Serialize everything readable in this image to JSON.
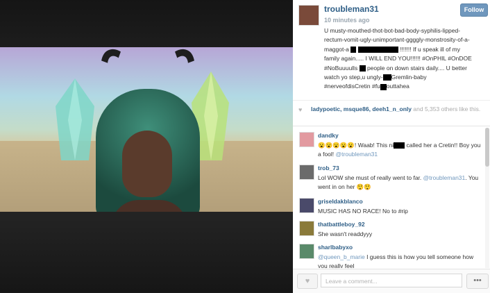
{
  "post": {
    "username": "troubleman31",
    "time": "10 minutes ago",
    "follow_label": "Follow",
    "caption": [
      "U musty-mouthed-thot-bot-bad-body-syphilis-lipped-",
      "rectum-vomit-ugly-unimportant-ggggly-monstrosity-of-a-",
      "maggot-a",
      "!!!!!!! If u speak ill of my",
      "family again..... I WILL END YOU!!!!!! #OnPHIL #OnDOE",
      "#NoBuuuulls",
      "people on down stairs daily.... U better",
      "watch yo step,u ungly-",
      "Gremlin-baby",
      "#nerveofdisCretin #fu",
      "outtahea"
    ]
  },
  "likes": {
    "names": "ladypoetic, msque86, deeh1_n_only",
    "rest": "and 5,353 others like this."
  },
  "comments": [
    {
      "user": "dandky",
      "text": "😮😮😮😮😮! Waab! This ni",
      "text2": "called her a Cretin!! Boy you a fool! ",
      "mention": "@troubleman31",
      "color": "#e29aa0"
    },
    {
      "user": "trob_73",
      "text": "Lol WOW she must of really went to far. ",
      "mention": "@troubleman31",
      "text2": ". You went in on her 😲😲",
      "color": "#6b6b6b"
    },
    {
      "user": "griseldakblanco",
      "text": "MUSIC HAS NO RACE! No to #rip",
      "color": "#4a4a6a"
    },
    {
      "user": "thatbattleboy_92",
      "text": "She wasn't readdyyy",
      "color": "#8a7a3a"
    },
    {
      "user": "sharlbabyxo",
      "mention": "@queen_b_marie",
      "text": " I guess this is how you tell someone how you really feel",
      "color": "#5a8a6a"
    }
  ],
  "footer": {
    "comment_placeholder": "Leave a comment...",
    "more_label": "•••",
    "like_icon": "heart-icon"
  },
  "colors": {
    "link": "#2e5e86",
    "follow_bg": "#6f97bd"
  }
}
